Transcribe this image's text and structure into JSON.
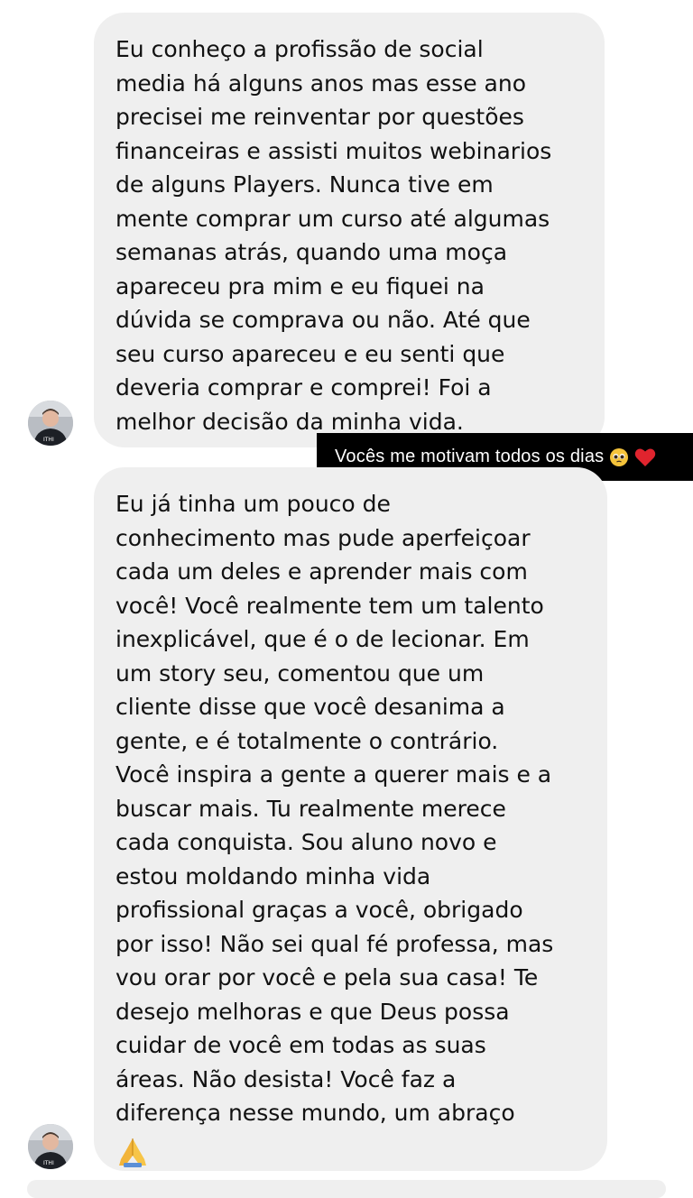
{
  "chat": {
    "messages": [
      {
        "lines": [
          "Eu conheço a profissão de social",
          "media há alguns anos mas esse ano",
          "precisei me reinventar por questões",
          "financeiras e assisti muitos webinarios",
          "de alguns Players. Nunca tive em",
          "mente comprar um curso até algumas",
          "semanas atrás, quando uma moça",
          "apareceu pra mim e eu fiquei na",
          "dúvida se comprava ou não. Até que",
          "seu curso apareceu e eu senti que",
          "deveria comprar e comprei! Foi a",
          "melhor decisão da minha vida."
        ]
      },
      {
        "lines": [
          "Eu já tinha um pouco de",
          "conhecimento mas pude aperfeiçoar",
          "cada um deles e aprender mais com",
          "você! Você realmente tem um talento",
          "inexplicável, que é o de lecionar. Em",
          "um story seu, comentou que um",
          "cliente disse que você desanima a",
          "gente, e é totalmente o contrário.",
          "Você inspira a gente a querer mais e a",
          "buscar mais. Tu realmente merece",
          "cada conquista. Sou aluno novo e",
          "estou moldando minha vida",
          "profissional graças a você, obrigado",
          "por isso! Não sei qual fé professa, mas",
          "vou orar por você e pela sua casa! Te",
          "desejo melhoras e que Deus possa",
          "cuidar de você em todas as suas",
          "áreas. Não desista! Você faz a",
          "diferença nesse mundo, um abraço"
        ],
        "emoji": "folded-hands-emoji"
      }
    ]
  },
  "overlay": {
    "text": "Vocês me motivam todos os dias",
    "emojis": [
      "pleading-face-emoji",
      "red-heart-emoji"
    ]
  },
  "colors": {
    "bubble_bg": "#efefef",
    "text": "#111111",
    "overlay_bg": "#000000",
    "overlay_text": "#ffffff",
    "heart": "#e0242e",
    "face": "#f5c33b"
  }
}
